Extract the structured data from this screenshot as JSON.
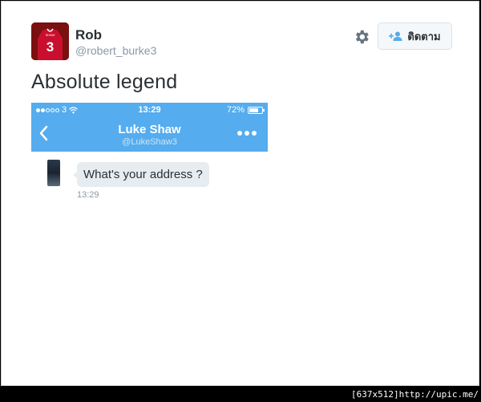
{
  "tweet": {
    "display_name": "Rob",
    "handle": "@robert_burke3",
    "text": "Absolute legend",
    "follow_label": "ติดตาม",
    "avatar_jersey_name": "SHAW",
    "avatar_jersey_number": "3"
  },
  "media": {
    "status": {
      "carrier": "3",
      "time": "13:29",
      "battery": "72%",
      "battery_level": 0.72,
      "signal_bars_filled": 2,
      "signal_bars_total": 5
    },
    "chat": {
      "name": "Luke Shaw",
      "handle": "@LukeShaw3",
      "message": "What's your address ?",
      "message_time": "13:29"
    },
    "header_color": "#55acee"
  },
  "footer": {
    "text": "[637x512]http://upic.me/"
  },
  "colors": {
    "name_text": "#292f33",
    "muted_text": "#8899a6",
    "accent_blue": "#55acee",
    "bubble_bg": "#e6ecf0"
  }
}
